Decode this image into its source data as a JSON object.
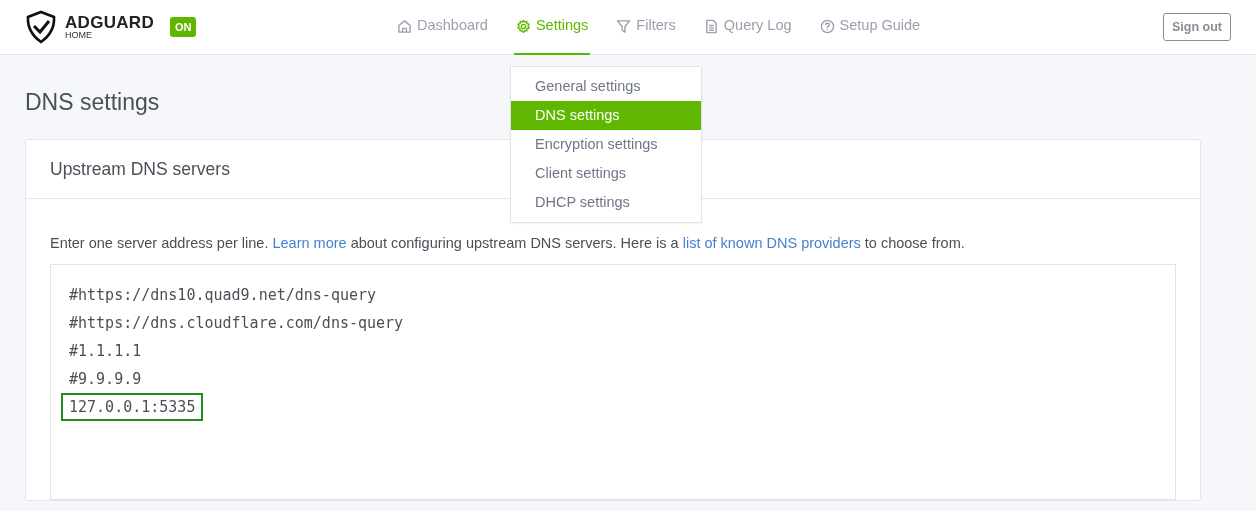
{
  "brand": {
    "name": "ADGUARD",
    "sub": "HOME",
    "status": "ON"
  },
  "nav": [
    {
      "label": "Dashboard",
      "selected": false
    },
    {
      "label": "Settings",
      "selected": true
    },
    {
      "label": "Filters",
      "selected": false
    },
    {
      "label": "Query Log",
      "selected": false
    },
    {
      "label": "Setup Guide",
      "selected": false
    }
  ],
  "sign_out": "Sign out",
  "settings_menu": {
    "expanded": true,
    "items": [
      {
        "label": "General settings",
        "selected": false
      },
      {
        "label": "DNS settings",
        "selected": true
      },
      {
        "label": "Encryption settings",
        "selected": false
      },
      {
        "label": "Client settings",
        "selected": false
      },
      {
        "label": "DHCP settings",
        "selected": false
      }
    ]
  },
  "page_title": "DNS settings",
  "card": {
    "title": "Upstream DNS servers",
    "description": [
      {
        "kind": "text",
        "text": "Enter one server address per line. "
      },
      {
        "kind": "link",
        "text": "Learn more"
      },
      {
        "kind": "text",
        "text": " about configuring upstream DNS servers. Here is a "
      },
      {
        "kind": "link",
        "text": "list of known DNS providers"
      },
      {
        "kind": "text",
        "text": " to choose from."
      }
    ],
    "servers": [
      {
        "text": "#https://dns10.quad9.net/dns-query",
        "highlighted": false
      },
      {
        "text": "#https://dns.cloudflare.com/dns-query",
        "highlighted": false
      },
      {
        "text": "#1.1.1.1",
        "highlighted": false
      },
      {
        "text": "#9.9.9.9",
        "highlighted": false
      },
      {
        "text": "127.0.0.1:5335",
        "highlighted": true
      }
    ]
  }
}
